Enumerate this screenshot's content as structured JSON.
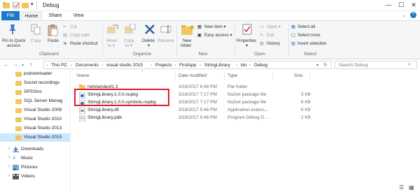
{
  "window": {
    "title": "Debug",
    "controls": {
      "minimize": "—",
      "maximize": "☐",
      "close": "✕"
    }
  },
  "ribbon_tabs": [
    {
      "label": "File"
    },
    {
      "label": "Home"
    },
    {
      "label": "Share"
    },
    {
      "label": "View"
    }
  ],
  "ribbon": {
    "clipboard": {
      "label": "Clipboard",
      "pin_label_1": "Pin to Quick",
      "pin_label_2": "access",
      "copy": "Copy",
      "paste": "Paste",
      "cut": "Cut",
      "copy_path": "Copy path",
      "paste_shortcut": "Paste shortcut"
    },
    "organize": {
      "label": "Organize",
      "move_to_1": "Move",
      "move_to_2": "to ▾",
      "copy_to_1": "Copy",
      "copy_to_2": "to ▾",
      "delete_1": "Delete",
      "delete_2": "▾",
      "rename": "Rename"
    },
    "new": {
      "label": "New",
      "new_folder_1": "New",
      "new_folder_2": "folder",
      "new_item": "New item ▾",
      "easy_access": "Easy access ▾"
    },
    "open": {
      "label": "Open",
      "properties_1": "Properties",
      "properties_2": "▾",
      "open": "Open ▾",
      "edit": "Edit",
      "history": "History"
    },
    "select": {
      "label": "Select",
      "select_all": "Select all",
      "select_none": "Select none",
      "invert_selection": "Invert selection"
    }
  },
  "address": {
    "back": "←",
    "forward": "→",
    "recent": "▾",
    "up": "↑",
    "crumbs": [
      "This PC",
      "Documents",
      "visual studio 2015",
      "Projects",
      "FirstApp",
      "StringLibrary",
      "bin",
      "Debug"
    ],
    "separator": "›",
    "refresh": "↻",
    "search_placeholder": "Search Debug"
  },
  "navpane": {
    "items": [
      {
        "label": "psdownloader"
      },
      {
        "label": "Sound recordings"
      },
      {
        "label": "SPSSInc"
      },
      {
        "label": "SQL Server Manag"
      },
      {
        "label": "Visual Studio 2008"
      },
      {
        "label": "Visual Studio 2010"
      },
      {
        "label": "Visual Studio 2013"
      },
      {
        "label": "Visual Studio 2015"
      }
    ],
    "places": [
      {
        "label": "Downloads",
        "arrow": "›"
      },
      {
        "label": "Music",
        "arrow": "›"
      },
      {
        "label": "Pictures",
        "arrow": "›"
      },
      {
        "label": "Videos",
        "arrow": "›"
      }
    ]
  },
  "columns": {
    "name": "Name",
    "date": "Date modified",
    "type": "Type",
    "size": "Size",
    "sort_indicator": "^"
  },
  "files": [
    {
      "name": "netstandard1.3",
      "date": "3/18/2017 6:48 PM",
      "type": "File folder",
      "size": ""
    },
    {
      "name": "StringLibrary.1.0.0.nupkg",
      "date": "3/18/2017 7:17 PM",
      "type": "NuGet package file",
      "size": "3 KB"
    },
    {
      "name": "StringLibrary.1.0.0.symbols.nupkg",
      "date": "3/18/2017 7:17 PM",
      "type": "NuGet package file",
      "size": "6 KB"
    },
    {
      "name": "StringLibrary.dll",
      "date": "3/18/2017 5:46 PM",
      "type": "Application extens...",
      "size": "5 KB"
    },
    {
      "name": "StringLibrary.pdb",
      "date": "3/18/2017 5:46 PM",
      "type": "Program Debug D...",
      "size": "2 KB"
    }
  ],
  "colors": {
    "accent": "#1979ca",
    "highlight_box": "#e31b23",
    "selection": "#cce8ff",
    "folder": "#f0c75e"
  }
}
